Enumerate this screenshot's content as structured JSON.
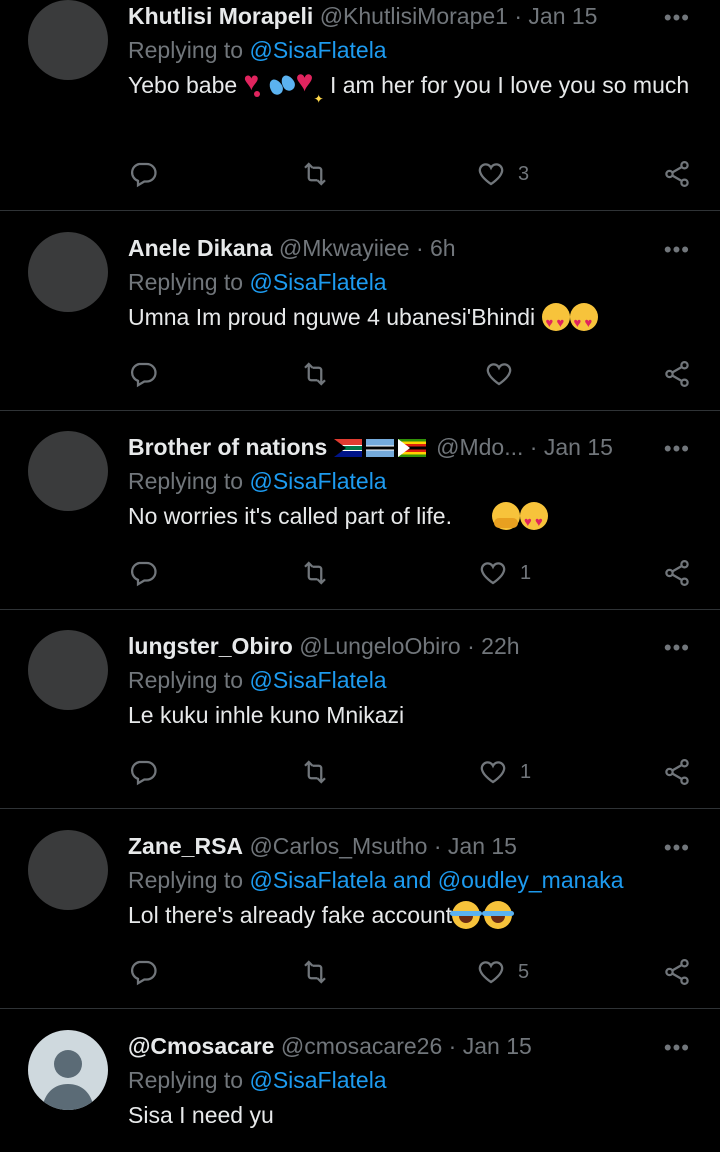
{
  "colors": {
    "background": "#000000",
    "primary_text": "#e7e9ea",
    "secondary_text": "#71767b",
    "accent": "#1d9bf0",
    "divider": "#2f3336"
  },
  "tweets": [
    {
      "name": "Khutlisi Morapeli",
      "handle": "@KhutlisiMorape1",
      "separator": "·",
      "time": "Jan 15",
      "reply_prefix": "Replying to ",
      "mention1": "@SisaFlatela",
      "text_a": "Yebo babe ",
      "text_b": " I am her for you I love you so much",
      "emoji_icons": [
        "heart-exclamation-icon",
        "sweat-droplets-icon",
        "sparkling-heart-icon"
      ],
      "likes": "3",
      "more": "•••"
    },
    {
      "name": "Anele Dikana",
      "handle": "@Mkwayiiee",
      "separator": "·",
      "time": "6h",
      "reply_prefix": "Replying to ",
      "mention1": "@SisaFlatela",
      "text_a": "Umna Im proud nguwe 4 ubanesi'Bhindi ",
      "emoji_icons": [
        "heart-eyes-icon",
        "heart-eyes-icon"
      ],
      "likes": "",
      "more": "•••"
    },
    {
      "name": "Brother of nations",
      "handle": "@Mdo...",
      "separator": "·",
      "time": "Jan 15",
      "reply_prefix": "Replying to ",
      "mention1": "@SisaFlatela",
      "text_a": "No worries it's called part of life.",
      "name_flags": [
        "south-africa-flag-icon",
        "botswana-flag-icon",
        "zimbabwe-flag-icon"
      ],
      "emoji_icons": [
        "hugging-face-icon",
        "heart-eyes-icon"
      ],
      "likes": "1",
      "more": "•••"
    },
    {
      "name": "lungster_Obiro",
      "handle": "@LungeloObiro",
      "separator": "·",
      "time": "22h",
      "reply_prefix": "Replying to ",
      "mention1": "@SisaFlatela",
      "text_a": "Le kuku inhle kuno Mnikazi",
      "likes": "1",
      "more": "•••"
    },
    {
      "name": "Zane_RSA",
      "handle": "@Carlos_Msutho",
      "separator": "·",
      "time": "Jan 15",
      "reply_prefix": "Replying to ",
      "mention1": "@SisaFlatela",
      "mention_join": " and ",
      "mention2": "@oudley_manaka",
      "text_a": "Lol there's already fake account",
      "emoji_icons": [
        "tears-of-joy-icon",
        "tears-of-joy-icon"
      ],
      "likes": "5",
      "more": "•••"
    },
    {
      "name": "@Cmosacare",
      "handle": "@cmosacare26",
      "separator": "·",
      "time": "Jan 15",
      "reply_prefix": "Replying to ",
      "mention1": "@SisaFlatela",
      "text_a": "Sisa I need yu",
      "more": "•••"
    }
  ]
}
